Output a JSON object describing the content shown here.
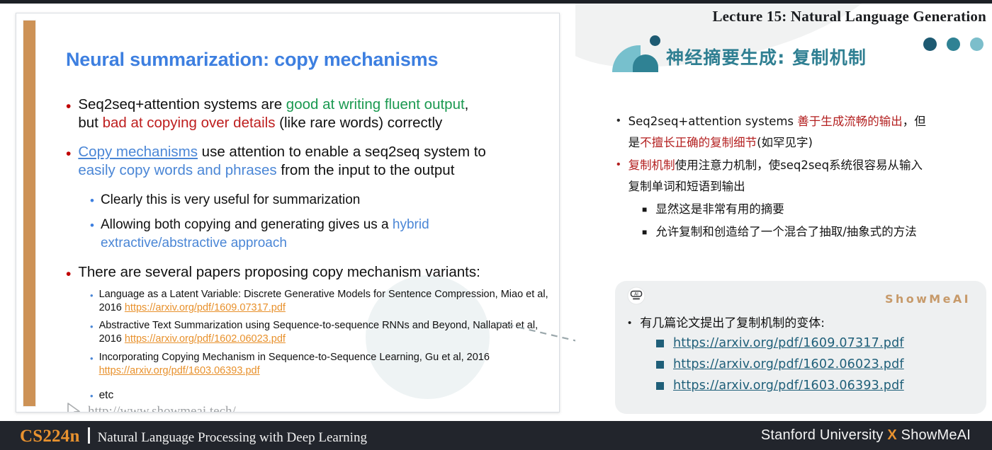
{
  "footer": {
    "course_code": "CS224n",
    "course_name": "Natural Language Processing with Deep Learning",
    "right_before": "Stanford University ",
    "right_x": "X",
    "right_after": " ShowMeAI"
  },
  "right_panel": {
    "lecture_title": "Lecture 15: Natural Language Generation",
    "cn_title": "神经摘要生成: 复制机制",
    "dots": [
      "#1d5a72",
      "#2f8294",
      "#7cbecb"
    ],
    "bullets": [
      {
        "marker": "•",
        "marker_color": "black",
        "line1_a": "Seq2seq+attention systems ",
        "line1_red": "善于生成流畅的输出",
        "line1_b": "，但",
        "line2_a": "是",
        "line2_red": "不擅长正确的复制细节",
        "line2_b": "(如罕见字)"
      },
      {
        "marker": "•",
        "marker_color": "red",
        "line1_red": "复制机制",
        "line1_b": "使用注意力机制，使seq2seq系统很容易从输入",
        "line2_b": "复制单词和短语到输出"
      }
    ],
    "sub_bullets": [
      "显然这是非常有用的摘要",
      "允许复制和创造给了一个混合了抽取/抽象式的方法"
    ]
  },
  "card": {
    "brand": "ShowMeAI",
    "robot_icon": "robot-face-icon",
    "lead": "有几篇论文提出了复制机制的变体:",
    "links": [
      "https://arxiv.org/pdf/1609.07317.pdf",
      "https://arxiv.org/pdf/1602.06023.pdf",
      "https://arxiv.org/pdf/1603.06393.pdf"
    ]
  },
  "slide": {
    "title": "Neural summarization: copy mechanisms",
    "watermark": "http://www.showmeai.tech/",
    "bullet1": {
      "l1_a": "Seq2seq+attention systems are ",
      "l1_green": "good at writing fluent output",
      "l1_b": ",",
      "l2_a": "but ",
      "l2_red": "bad at copying over details",
      "l2_b": " (like rare words) correctly"
    },
    "bullet2": {
      "l1_link": "Copy mechanisms",
      "l1_b": " use attention to enable a seq2seq system to",
      "l2_blue": "easily copy words and phrases",
      "l2_b": " from the input to the output"
    },
    "sub1": "Clearly this is very useful for summarization",
    "sub2_a": "Allowing both copying and generating gives us a ",
    "sub2_blue": "hybrid",
    "sub2_blue2": "extractive/abstractive approach",
    "bullet3": "There are several papers proposing copy mechanism variants:",
    "papers": [
      {
        "text": "Language as a Latent Variable: Discrete Generative Models for Sentence Compression, Miao et al, 2016 ",
        "url": "https://arxiv.org/pdf/1609.07317.pdf"
      },
      {
        "text": "Abstractive Text Summarization using Sequence-to-sequence RNNs and Beyond, Nallapati et al, 2016 ",
        "url": "https://arxiv.org/pdf/1602.06023.pdf"
      },
      {
        "text": "Incorporating Copying Mechanism in Sequence-to-Sequence Learning, Gu et al, 2016 ",
        "url": "https://arxiv.org/pdf/1603.06393.pdf"
      }
    ],
    "etc": "etc"
  }
}
